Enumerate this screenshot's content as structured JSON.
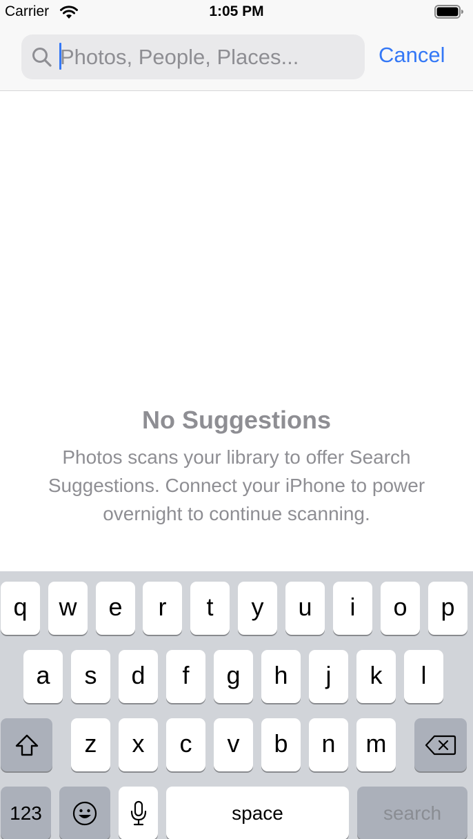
{
  "status_bar": {
    "carrier": "Carrier",
    "time": "1:05 PM",
    "icons": [
      "wifi-icon",
      "battery-icon"
    ]
  },
  "search": {
    "placeholder": "Photos, People, Places...",
    "value": "",
    "cancel_label": "Cancel",
    "icon": "search-icon"
  },
  "empty_state": {
    "title": "No Suggestions",
    "message": "Photos scans your library to offer Search Suggestions. Connect your iPhone to power overnight to continue scanning."
  },
  "keyboard": {
    "row1": [
      "q",
      "w",
      "e",
      "r",
      "t",
      "y",
      "u",
      "i",
      "o",
      "p"
    ],
    "row2": [
      "a",
      "s",
      "d",
      "f",
      "g",
      "h",
      "j",
      "k",
      "l"
    ],
    "row3": [
      "z",
      "x",
      "c",
      "v",
      "b",
      "n",
      "m"
    ],
    "shift_icon": "shift-icon",
    "delete_icon": "backspace-icon",
    "numbers_label": "123",
    "emoji_icon": "emoji-icon",
    "mic_icon": "microphone-icon",
    "space_label": "space",
    "return_label": "search"
  },
  "colors": {
    "accent": "#3478f6",
    "placeholder": "#8e8e93",
    "keyboard_background": "#d1d4d9",
    "dark_key": "#abb0ba"
  }
}
